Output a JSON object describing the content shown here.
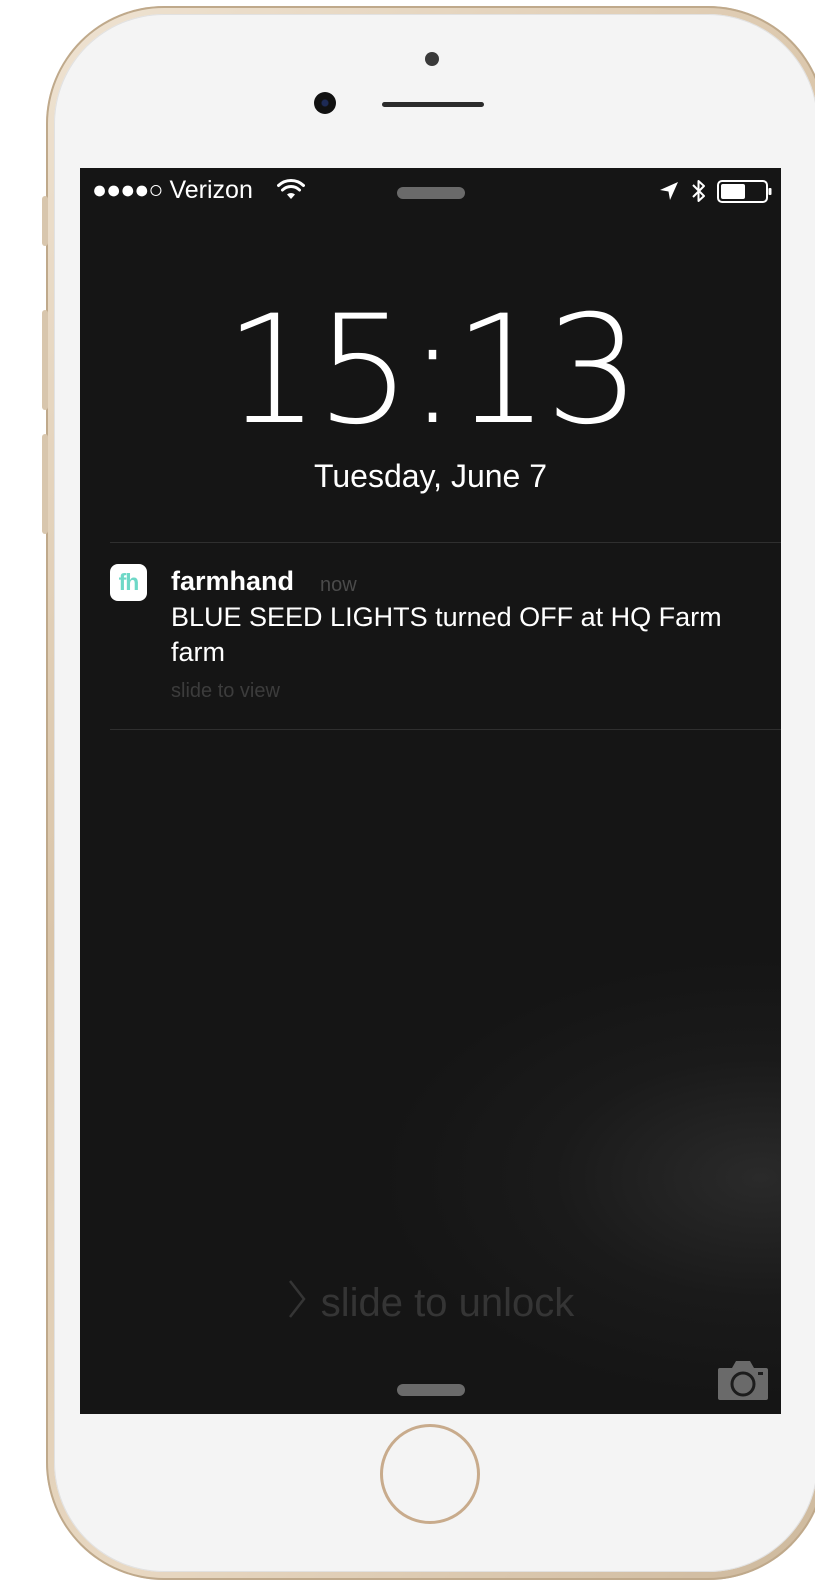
{
  "status_bar": {
    "signal": "●●●●○",
    "carrier": "Verizon",
    "icons": [
      "wifi-icon",
      "location-arrow-icon",
      "bluetooth-icon",
      "battery-icon"
    ]
  },
  "lock_screen": {
    "time": "15:13",
    "date": "Tuesday, June 7"
  },
  "notification": {
    "app_icon_text": "fh",
    "app_name": "farmhand",
    "time": "now",
    "message": "BLUE SEED LIGHTS turned OFF at HQ Farm farm",
    "action_hint": "slide to view"
  },
  "unlock": {
    "label": "slide to unlock"
  },
  "colors": {
    "screen_background": "#151515",
    "app_icon_accent": "#6ed8c7",
    "phone_frame": "#d9c4a8"
  }
}
